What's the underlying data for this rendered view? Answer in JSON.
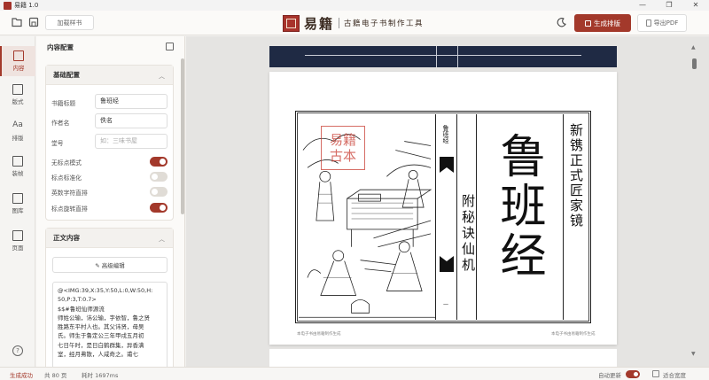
{
  "window": {
    "title": "易籍 1.0",
    "controls": [
      "—",
      "❐",
      "✕"
    ]
  },
  "toolbar": {
    "add_bookmark": "加载样书",
    "brand_name": "易籍",
    "brand_tagline": "古籍电子书制作工具",
    "generate_label": "生成排版",
    "export_label": "导出PDF"
  },
  "rail": [
    {
      "label": "内容",
      "active": true
    },
    {
      "label": "版式"
    },
    {
      "label": "排版"
    },
    {
      "label": "装帧"
    },
    {
      "label": "图库"
    },
    {
      "label": "页面"
    }
  ],
  "panel": {
    "title": "内容配置",
    "basic": {
      "title": "基础配置",
      "book_title_label": "书籍标题",
      "book_title_value": "鲁班经",
      "author_label": "作者名",
      "author_value": "佚名",
      "publisher_label": "堂号",
      "publisher_placeholder": "如：三味书屋",
      "toggles": [
        {
          "label": "无标点模式",
          "on": true
        },
        {
          "label": "标点标准化",
          "on": false
        },
        {
          "label": "英数字符直排",
          "on": false
        },
        {
          "label": "标点旋转直排",
          "on": true
        }
      ]
    },
    "content": {
      "title": "正文内容",
      "advanced_label": "✎ 高级编辑",
      "lines": [
        "@<IMG:39,X:35,Y:50,L:0,W:50,H:",
        "50,P:3,T:0.7>",
        "$$#鲁班仙师源流",
        "师姓公输，讳公输，字依智，鲁之贤",
        "胜路东平村人也。其父讳贤，母吴",
        "氏。师生于鲁定公三年甲戌五月初",
        "七日午时，是日白鹤群集，异香满",
        "室，经月弗散，人咸奇之。甫七"
      ]
    }
  },
  "preview": {
    "running_title": "鲁班经",
    "big_title": "鲁班经",
    "subtitle": "新镌正式匠家镜",
    "appendix": "附秘诀仙机",
    "stamp_text": "易籍古本",
    "footer_left": "本电子书由易籍制作生成",
    "footer_right": "本电子书由易籍制作生成",
    "fold_mark": "一"
  },
  "status": {
    "message": "生成成功",
    "pages": "共 80 页",
    "time": "耗时 1697ms",
    "auto_update": "自动更新",
    "zoom": "适合宽度",
    "auto_update_on": true
  }
}
